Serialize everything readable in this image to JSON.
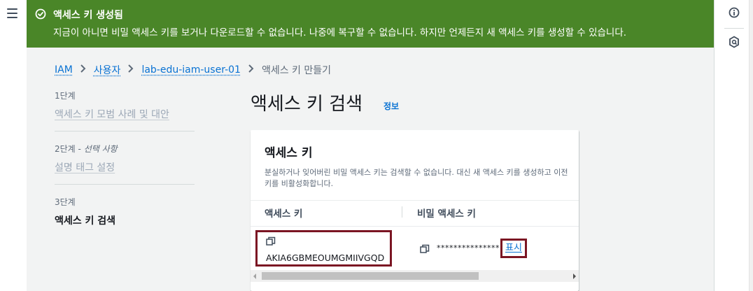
{
  "flash": {
    "title": "액세스 키 생성됨",
    "message": "지금이 아니면 비밀 액세스 키를 보거나 다운로드할 수 없습니다. 나중에 복구할 수 없습니다. 하지만 언제든지 새 액세스 키를 생성할 수 있습니다.",
    "background_color": "#4a8628",
    "icon": "success-check-icon"
  },
  "breadcrumb": {
    "items": [
      "IAM",
      "사용자",
      "lab-edu-iam-user-01"
    ],
    "current": "액세스 키 만들기"
  },
  "steps": [
    {
      "number": "1단계",
      "optional": "",
      "label": "액세스 키 모범 사례 및 대안"
    },
    {
      "number": "2단계 - ",
      "optional": "선택 사항",
      "label": "설명 태그 설정"
    },
    {
      "number": "3단계",
      "optional": "",
      "label": "액세스 키 검색"
    }
  ],
  "page": {
    "title": "액세스 키 검색",
    "info_link": "정보"
  },
  "panel": {
    "title": "액세스 키",
    "description": "분실하거나 잊어버린 비밀 액세스 키는 검색할 수 없습니다. 대신 새 액세스 키를 생성하고 이전 키를 비활성화합니다.",
    "columns": [
      "액세스 키",
      "비밀 액세스 키"
    ],
    "access_key": "AKIA6GBMEOUMGMIIVGQD",
    "secret_masked": "***************",
    "show_label": "표시"
  },
  "colors": {
    "link": "#0972d3",
    "highlight_border": "#7b1523"
  }
}
